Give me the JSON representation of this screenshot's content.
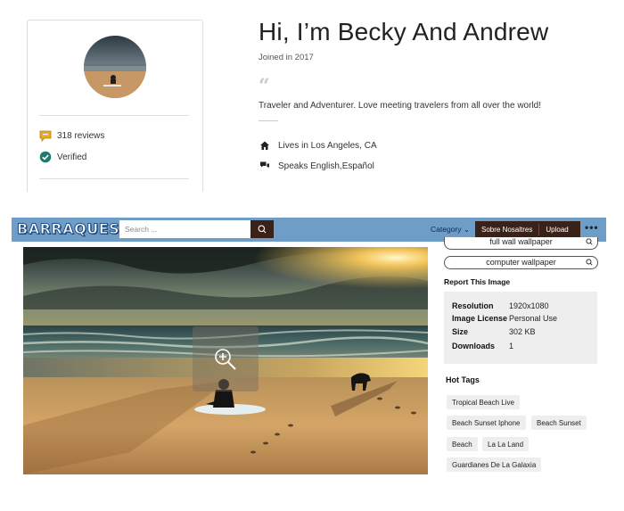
{
  "profile": {
    "greeting": "Hi, I’m Becky And Andrew",
    "joined": "Joined in 2017",
    "quote_mark": "“",
    "about": "Traveler and Adventurer. Love meeting travelers from all over the world!",
    "reviews": "318 reviews",
    "verified": "Verified",
    "lives_in": "Lives in Los Angeles, CA",
    "speaks": "Speaks English,Español",
    "icons": {
      "reviews": "speech-bubble-icon",
      "verified": "verified-badge-icon",
      "lives_in": "home-icon",
      "speaks": "chat-bubbles-icon"
    }
  },
  "site": {
    "logo": "BARRAQUES",
    "search": {
      "placeholder": "Search ..."
    },
    "nav": {
      "category": "Category ⌄",
      "sobre": "Sobre Nosaltres",
      "upload": "Upload",
      "more": "•••"
    },
    "colors": {
      "navbar": "#6e9dc8",
      "dark_button": "#3b2218",
      "panel_bg": "#eeeeee"
    },
    "related_tags": [
      {
        "label": "full wall wallpaper"
      },
      {
        "label": "computer wallpaper"
      }
    ],
    "report": "Report This Image",
    "image_info": [
      {
        "key": "Resolution",
        "value": "1920x1080"
      },
      {
        "key": "Image License",
        "value": "Personal Use"
      },
      {
        "key": "Size",
        "value": "302 KB"
      },
      {
        "key": "Downloads",
        "value": "1"
      }
    ],
    "hot_tags_title": "Hot Tags",
    "hot_tags": [
      "Tropical Beach Live",
      "Beach Sunset Iphone",
      "Beach Sunset",
      "Beach",
      "La La Land",
      "Guardianes De La Galaxia"
    ]
  }
}
